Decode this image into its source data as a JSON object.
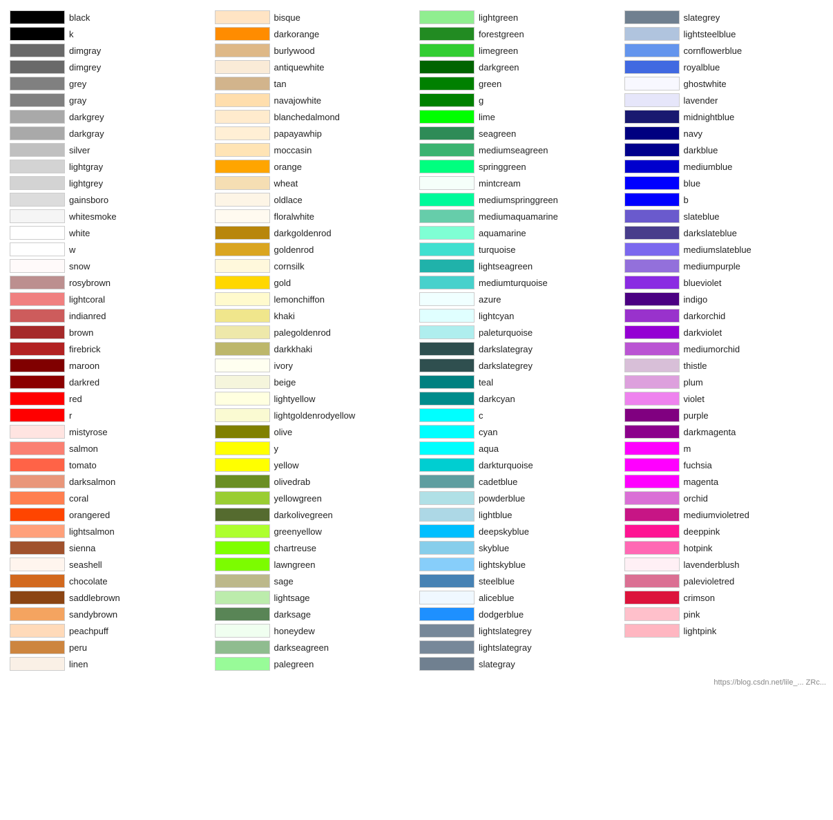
{
  "columns": [
    {
      "items": [
        {
          "name": "black",
          "color": "#000000"
        },
        {
          "name": "k",
          "color": "#000000"
        },
        {
          "name": "dimgray",
          "color": "#696969"
        },
        {
          "name": "dimgrey",
          "color": "#696969"
        },
        {
          "name": "grey",
          "color": "#808080"
        },
        {
          "name": "gray",
          "color": "#808080"
        },
        {
          "name": "darkgrey",
          "color": "#a9a9a9"
        },
        {
          "name": "darkgray",
          "color": "#a9a9a9"
        },
        {
          "name": "silver",
          "color": "#c0c0c0"
        },
        {
          "name": "lightgray",
          "color": "#d3d3d3"
        },
        {
          "name": "lightgrey",
          "color": "#d3d3d3"
        },
        {
          "name": "gainsboro",
          "color": "#dcdcdc"
        },
        {
          "name": "whitesmoke",
          "color": "#f5f5f5"
        },
        {
          "name": "white",
          "color": "#ffffff"
        },
        {
          "name": "w",
          "color": "#ffffff"
        },
        {
          "name": "snow",
          "color": "#fffafa"
        },
        {
          "name": "rosybrown",
          "color": "#bc8f8f"
        },
        {
          "name": "lightcoral",
          "color": "#f08080"
        },
        {
          "name": "indianred",
          "color": "#cd5c5c"
        },
        {
          "name": "brown",
          "color": "#a52a2a"
        },
        {
          "name": "firebrick",
          "color": "#b22222"
        },
        {
          "name": "maroon",
          "color": "#800000"
        },
        {
          "name": "darkred",
          "color": "#8b0000"
        },
        {
          "name": "red",
          "color": "#ff0000"
        },
        {
          "name": "r",
          "color": "#ff0000"
        },
        {
          "name": "mistyrose",
          "color": "#ffe4e1"
        },
        {
          "name": "salmon",
          "color": "#fa8072"
        },
        {
          "name": "tomato",
          "color": "#ff6347"
        },
        {
          "name": "darksalmon",
          "color": "#e9967a"
        },
        {
          "name": "coral",
          "color": "#ff7f50"
        },
        {
          "name": "orangered",
          "color": "#ff4500"
        },
        {
          "name": "lightsalmon",
          "color": "#ffa07a"
        },
        {
          "name": "sienna",
          "color": "#a0522d"
        },
        {
          "name": "seashell",
          "color": "#fff5ee"
        },
        {
          "name": "chocolate",
          "color": "#d2691e"
        },
        {
          "name": "saddlebrown",
          "color": "#8b4513"
        },
        {
          "name": "sandybrown",
          "color": "#f4a460"
        },
        {
          "name": "peachpuff",
          "color": "#ffdab9"
        },
        {
          "name": "peru",
          "color": "#cd853f"
        },
        {
          "name": "linen",
          "color": "#faf0e6"
        }
      ]
    },
    {
      "items": [
        {
          "name": "bisque",
          "color": "#ffe4c4"
        },
        {
          "name": "darkorange",
          "color": "#ff8c00"
        },
        {
          "name": "burlywood",
          "color": "#deb887"
        },
        {
          "name": "antiquewhite",
          "color": "#faebd7"
        },
        {
          "name": "tan",
          "color": "#d2b48c"
        },
        {
          "name": "navajowhite",
          "color": "#ffdead"
        },
        {
          "name": "blanchedalmond",
          "color": "#ffebcd"
        },
        {
          "name": "papayawhip",
          "color": "#ffefd5"
        },
        {
          "name": "moccasin",
          "color": "#ffe4b5"
        },
        {
          "name": "orange",
          "color": "#ffa500"
        },
        {
          "name": "wheat",
          "color": "#f5deb3"
        },
        {
          "name": "oldlace",
          "color": "#fdf5e6"
        },
        {
          "name": "floralwhite",
          "color": "#fffaf0"
        },
        {
          "name": "darkgoldenrod",
          "color": "#b8860b"
        },
        {
          "name": "goldenrod",
          "color": "#daa520"
        },
        {
          "name": "cornsilk",
          "color": "#fff8dc"
        },
        {
          "name": "gold",
          "color": "#ffd700"
        },
        {
          "name": "lemonchiffon",
          "color": "#fffacd"
        },
        {
          "name": "khaki",
          "color": "#f0e68c"
        },
        {
          "name": "palegoldenrod",
          "color": "#eee8aa"
        },
        {
          "name": "darkkhaki",
          "color": "#bdb76b"
        },
        {
          "name": "ivory",
          "color": "#fffff0"
        },
        {
          "name": "beige",
          "color": "#f5f5dc"
        },
        {
          "name": "lightyellow",
          "color": "#ffffe0"
        },
        {
          "name": "lightgoldenrodyellow",
          "color": "#fafad2"
        },
        {
          "name": "olive",
          "color": "#808000"
        },
        {
          "name": "y",
          "color": "#ffff00"
        },
        {
          "name": "yellow",
          "color": "#ffff00"
        },
        {
          "name": "olivedrab",
          "color": "#6b8e23"
        },
        {
          "name": "yellowgreen",
          "color": "#9acd32"
        },
        {
          "name": "darkolivegreen",
          "color": "#556b2f"
        },
        {
          "name": "greenyellow",
          "color": "#adff2f"
        },
        {
          "name": "chartreuse",
          "color": "#7fff00"
        },
        {
          "name": "lawngreen",
          "color": "#7cfc00"
        },
        {
          "name": "sage",
          "color": "#bcb88a"
        },
        {
          "name": "lightsage",
          "color": "#bcecac"
        },
        {
          "name": "darksage",
          "color": "#598556"
        },
        {
          "name": "honeydew",
          "color": "#f0fff0"
        },
        {
          "name": "darkseagreen",
          "color": "#8fbc8f"
        },
        {
          "name": "palegreen",
          "color": "#98fb98"
        }
      ]
    },
    {
      "items": [
        {
          "name": "lightgreen",
          "color": "#90ee90"
        },
        {
          "name": "forestgreen",
          "color": "#228b22"
        },
        {
          "name": "limegreen",
          "color": "#32cd32"
        },
        {
          "name": "darkgreen",
          "color": "#006400"
        },
        {
          "name": "green",
          "color": "#008000"
        },
        {
          "name": "g",
          "color": "#008000"
        },
        {
          "name": "lime",
          "color": "#00ff00"
        },
        {
          "name": "seagreen",
          "color": "#2e8b57"
        },
        {
          "name": "mediumseagreen",
          "color": "#3cb371"
        },
        {
          "name": "springgreen",
          "color": "#00ff7f"
        },
        {
          "name": "mintcream",
          "color": "#f5fffa"
        },
        {
          "name": "mediumspringgreen",
          "color": "#00fa9a"
        },
        {
          "name": "mediumaquamarine",
          "color": "#66cdaa"
        },
        {
          "name": "aquamarine",
          "color": "#7fffd4"
        },
        {
          "name": "turquoise",
          "color": "#40e0d0"
        },
        {
          "name": "lightseagreen",
          "color": "#20b2aa"
        },
        {
          "name": "mediumturquoise",
          "color": "#48d1cc"
        },
        {
          "name": "azure",
          "color": "#f0ffff"
        },
        {
          "name": "lightcyan",
          "color": "#e0ffff"
        },
        {
          "name": "paleturquoise",
          "color": "#afeeee"
        },
        {
          "name": "darkslategray",
          "color": "#2f4f4f"
        },
        {
          "name": "darkslategrey",
          "color": "#2f4f4f"
        },
        {
          "name": "teal",
          "color": "#008080"
        },
        {
          "name": "darkcyan",
          "color": "#008b8b"
        },
        {
          "name": "c",
          "color": "#00ffff"
        },
        {
          "name": "cyan",
          "color": "#00ffff"
        },
        {
          "name": "aqua",
          "color": "#00ffff"
        },
        {
          "name": "darkturquoise",
          "color": "#00ced1"
        },
        {
          "name": "cadetblue",
          "color": "#5f9ea0"
        },
        {
          "name": "powderblue",
          "color": "#b0e0e6"
        },
        {
          "name": "lightblue",
          "color": "#add8e6"
        },
        {
          "name": "deepskyblue",
          "color": "#00bfff"
        },
        {
          "name": "skyblue",
          "color": "#87ceeb"
        },
        {
          "name": "lightskyblue",
          "color": "#87cefa"
        },
        {
          "name": "steelblue",
          "color": "#4682b4"
        },
        {
          "name": "aliceblue",
          "color": "#f0f8ff"
        },
        {
          "name": "dodgerblue",
          "color": "#1e90ff"
        },
        {
          "name": "lightslategrey",
          "color": "#778899"
        },
        {
          "name": "lightslategray",
          "color": "#778899"
        },
        {
          "name": "slategray",
          "color": "#708090"
        }
      ]
    },
    {
      "items": [
        {
          "name": "slategrey",
          "color": "#708090"
        },
        {
          "name": "lightsteelblue",
          "color": "#b0c4de"
        },
        {
          "name": "cornflowerblue",
          "color": "#6495ed"
        },
        {
          "name": "royalblue",
          "color": "#4169e1"
        },
        {
          "name": "ghostwhite",
          "color": "#f8f8ff"
        },
        {
          "name": "lavender",
          "color": "#e6e6fa"
        },
        {
          "name": "midnightblue",
          "color": "#191970"
        },
        {
          "name": "navy",
          "color": "#000080"
        },
        {
          "name": "darkblue",
          "color": "#00008b"
        },
        {
          "name": "mediumblue",
          "color": "#0000cd"
        },
        {
          "name": "blue",
          "color": "#0000ff"
        },
        {
          "name": "b",
          "color": "#0000ff"
        },
        {
          "name": "slateblue",
          "color": "#6a5acd"
        },
        {
          "name": "darkslateblue",
          "color": "#483d8b"
        },
        {
          "name": "mediumslateblue",
          "color": "#7b68ee"
        },
        {
          "name": "mediumpurple",
          "color": "#9370db"
        },
        {
          "name": "blueviolet",
          "color": "#8a2be2"
        },
        {
          "name": "indigo",
          "color": "#4b0082"
        },
        {
          "name": "darkorchid",
          "color": "#9932cc"
        },
        {
          "name": "darkviolet",
          "color": "#9400d3"
        },
        {
          "name": "mediumorchid",
          "color": "#ba55d3"
        },
        {
          "name": "thistle",
          "color": "#d8bfd8"
        },
        {
          "name": "plum",
          "color": "#dda0dd"
        },
        {
          "name": "violet",
          "color": "#ee82ee"
        },
        {
          "name": "purple",
          "color": "#800080"
        },
        {
          "name": "darkmagenta",
          "color": "#8b008b"
        },
        {
          "name": "m",
          "color": "#ff00ff"
        },
        {
          "name": "fuchsia",
          "color": "#ff00ff"
        },
        {
          "name": "magenta",
          "color": "#ff00ff"
        },
        {
          "name": "orchid",
          "color": "#da70d6"
        },
        {
          "name": "mediumvioletred",
          "color": "#c71585"
        },
        {
          "name": "deeppink",
          "color": "#ff1493"
        },
        {
          "name": "hotpink",
          "color": "#ff69b4"
        },
        {
          "name": "lavenderblush",
          "color": "#fff0f5"
        },
        {
          "name": "palevioletred",
          "color": "#db7093"
        },
        {
          "name": "crimson",
          "color": "#dc143c"
        },
        {
          "name": "pink",
          "color": "#ffc0cb"
        },
        {
          "name": "lightpink",
          "color": "#ffb6c1"
        }
      ]
    }
  ],
  "footer": "https://blog.csdn.net/lile_... ZRc..."
}
